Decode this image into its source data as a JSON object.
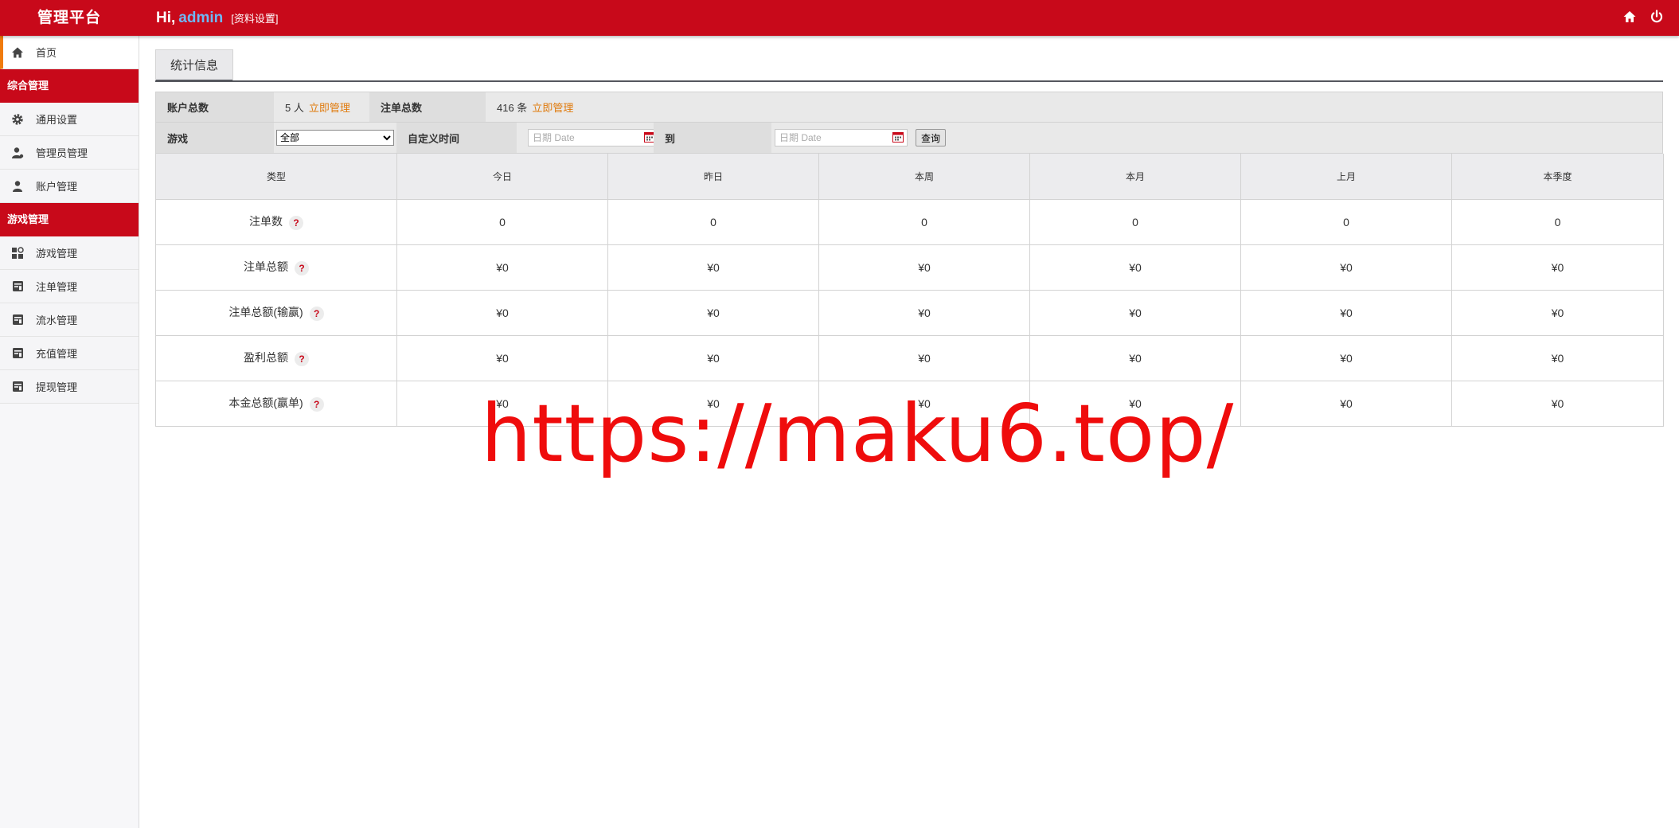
{
  "header": {
    "brand": "管理平台",
    "greeting": "Hi,",
    "username": "admin",
    "profile_link": "[资料设置]",
    "home_icon": "home-icon",
    "power_icon": "power-icon"
  },
  "sidebar": {
    "home": {
      "label": "首页",
      "icon": "home-icon"
    },
    "groups": [
      {
        "title": "综合管理",
        "items": [
          {
            "label": "通用设置",
            "icon": "gear-icon"
          },
          {
            "label": "管理员管理",
            "icon": "admin-user-icon"
          },
          {
            "label": "账户管理",
            "icon": "user-icon"
          }
        ]
      },
      {
        "title": "游戏管理",
        "items": [
          {
            "label": "游戏管理",
            "icon": "grid-icon"
          },
          {
            "label": "注单管理",
            "icon": "ledger-icon"
          },
          {
            "label": "流水管理",
            "icon": "ledger-icon"
          },
          {
            "label": "充值管理",
            "icon": "ledger-icon"
          },
          {
            "label": "提现管理",
            "icon": "ledger-icon"
          }
        ]
      }
    ]
  },
  "tabs": {
    "active": "统计信息"
  },
  "summary": {
    "accounts_label": "账户总数",
    "accounts_value": "5 人",
    "accounts_link": "立即管理",
    "bets_label": "注单总数",
    "bets_value": "416 条",
    "bets_link": "立即管理"
  },
  "filter": {
    "game_label": "游戏",
    "game_selected": "全部",
    "time_label": "自定义时间",
    "date_placeholder": "日期 Date",
    "to_label": "到",
    "query_button": "查询"
  },
  "table": {
    "headers": [
      "类型",
      "今日",
      "昨日",
      "本周",
      "本月",
      "上月",
      "本季度"
    ],
    "rows": [
      {
        "type": "注单数",
        "values": [
          "0",
          "0",
          "0",
          "0",
          "0",
          "0"
        ]
      },
      {
        "type": "注单总额",
        "values": [
          "¥0",
          "¥0",
          "¥0",
          "¥0",
          "¥0",
          "¥0"
        ]
      },
      {
        "type": "注单总额(输赢)",
        "values": [
          "¥0",
          "¥0",
          "¥0",
          "¥0",
          "¥0",
          "¥0"
        ]
      },
      {
        "type": "盈利总额",
        "values": [
          "¥0",
          "¥0",
          "¥0",
          "¥0",
          "¥0",
          "¥0"
        ]
      },
      {
        "type": "本金总额(赢单)",
        "values": [
          "¥0",
          "¥0",
          "¥0",
          "¥0",
          "¥0",
          "¥0"
        ]
      }
    ],
    "help_glyph": "?"
  },
  "watermark": "https://maku6.top/",
  "colors": {
    "brand_red": "#c8091a",
    "accent_orange": "#e07a0c",
    "username_blue": "#6fb7f5"
  }
}
